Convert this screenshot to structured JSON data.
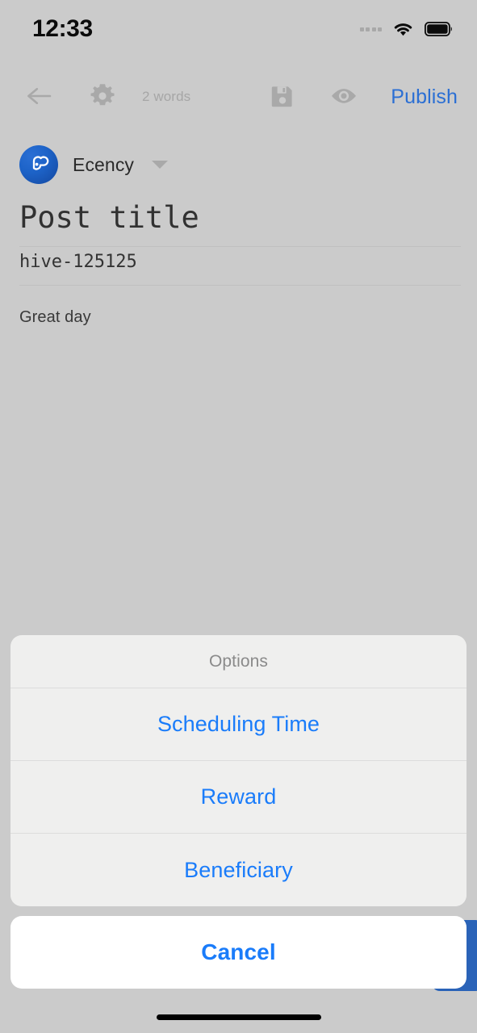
{
  "status_bar": {
    "time": "12:33",
    "signal_icon": "signal-dots-icon",
    "wifi_icon": "wifi-icon",
    "battery_icon": "battery-full-icon"
  },
  "toolbar": {
    "back_icon": "arrow-left-icon",
    "settings_icon": "gear-icon",
    "word_count": "2 words",
    "save_icon": "floppy-disk-save-icon",
    "preview_icon": "eye-preview-icon",
    "publish_label": "Publish",
    "publish_color": "#2b6fd4",
    "icon_color": "#a9a9a9"
  },
  "account": {
    "avatar_icon": "ecency-logo-icon",
    "name": "Ecency",
    "caret_icon": "chevron-down-icon",
    "avatar_color": "#1d63c8"
  },
  "editor": {
    "title": "Post title",
    "tags": "hive-125125",
    "body": "Great day"
  },
  "action_sheet": {
    "title": "Options",
    "options": [
      {
        "label": "Scheduling Time"
      },
      {
        "label": "Reward"
      },
      {
        "label": "Beneficiary"
      }
    ],
    "cancel_label": "Cancel",
    "accent_color": "#1a7cfa",
    "sheet_background": "#efefee"
  },
  "overlay": {
    "background_color": "#cbcbcb"
  },
  "home_indicator": {
    "color": "#000000"
  }
}
